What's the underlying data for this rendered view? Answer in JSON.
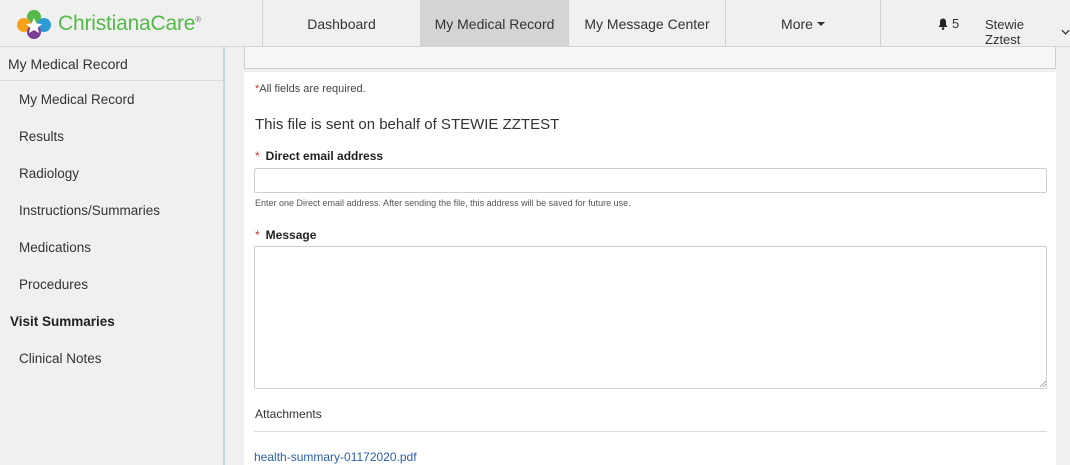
{
  "brand": {
    "name": "ChristianaCare",
    "trademark": "®",
    "accent_color": "#54b948"
  },
  "nav": {
    "items": [
      {
        "label": "Dashboard",
        "active": false
      },
      {
        "label": "My Medical Record",
        "active": true
      },
      {
        "label": "My Message Center",
        "active": false
      },
      {
        "label": "More",
        "active": false
      }
    ],
    "notifications": {
      "icon": "bell-icon",
      "count": "5"
    },
    "user": {
      "name": "Stewie Zztest",
      "icon": "chevron-down-icon"
    }
  },
  "sidebar": {
    "header": "My Medical Record",
    "items": [
      {
        "label": "My Medical Record",
        "bold": false
      },
      {
        "label": "Results",
        "bold": false
      },
      {
        "label": "Radiology",
        "bold": false
      },
      {
        "label": "Instructions/Summaries",
        "bold": false
      },
      {
        "label": "Medications",
        "bold": false
      },
      {
        "label": "Procedures",
        "bold": false
      },
      {
        "label": "Visit Summaries",
        "bold": true
      },
      {
        "label": "Clinical Notes",
        "bold": false
      }
    ]
  },
  "form": {
    "required_note": "All fields are required.",
    "required_star": "*",
    "behalf_text": "This file is sent on behalf of STEWIE ZZTEST",
    "email_label": "Direct email address",
    "email_value": "",
    "email_help": "Enter one Direct email address. After sending the file, this address will be saved for future use.",
    "message_label": "Message",
    "message_value": "",
    "attachments_title": "Attachments",
    "attachment_file": "health-summary-01172020.pdf",
    "link_color": "#2a5fa8",
    "required_color": "#c0392b"
  }
}
